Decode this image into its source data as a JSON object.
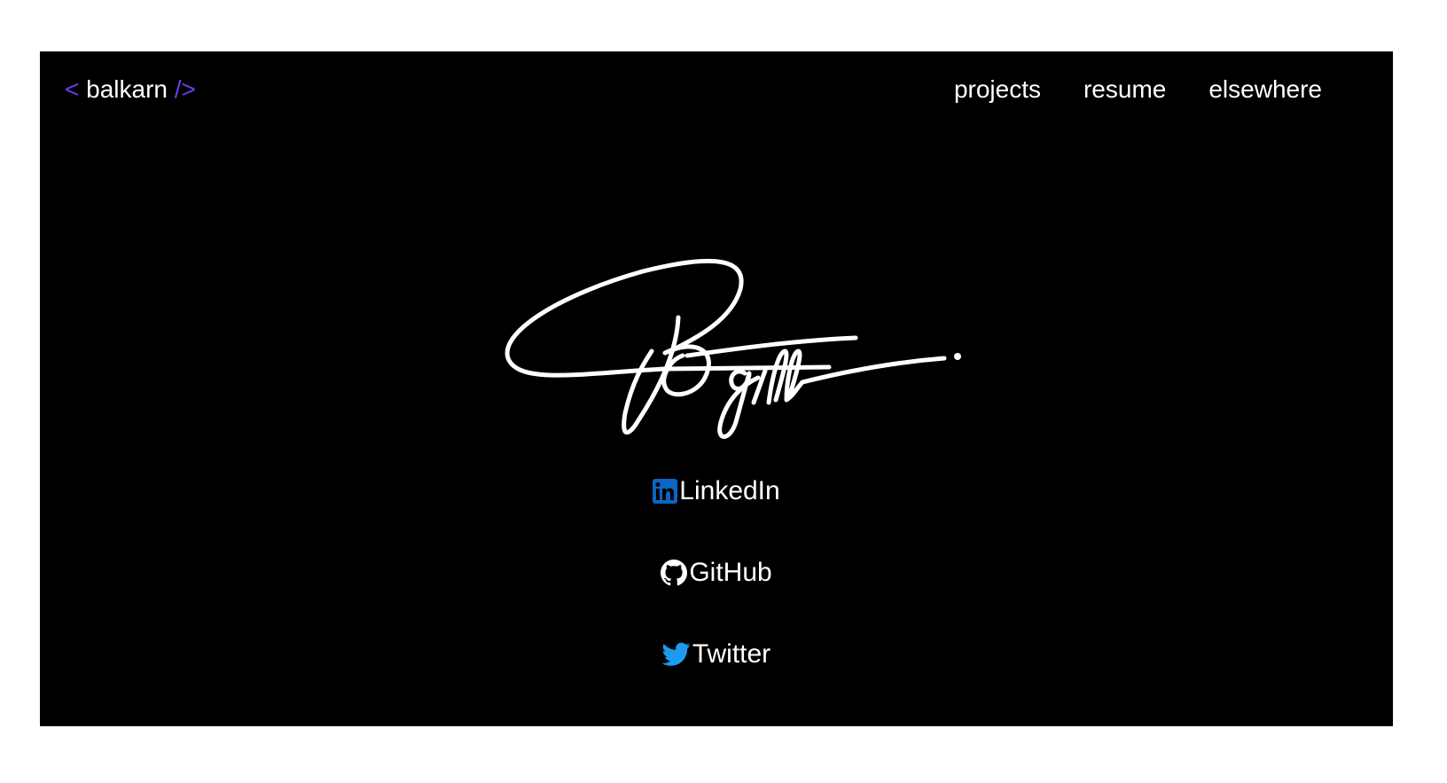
{
  "header": {
    "brand": {
      "open": "<",
      "name": "balkarn",
      "close": "/>"
    },
    "nav": [
      {
        "label": "projects"
      },
      {
        "label": "resume"
      },
      {
        "label": "elsewhere"
      }
    ]
  },
  "hero": {
    "signature_icon": "handwritten-signature",
    "signature_text": "BGill"
  },
  "socials": [
    {
      "label": "LinkedIn",
      "icon": "linkedin-icon",
      "color": "#0a66c2"
    },
    {
      "label": "GitHub",
      "icon": "github-icon",
      "color": "#ffffff"
    },
    {
      "label": "Twitter",
      "icon": "twitter-icon",
      "color": "#1d9bf0"
    }
  ],
  "colors": {
    "background": "#000000",
    "page": "#ffffff",
    "accent": "#6a3df0",
    "text": "#ffffff"
  }
}
